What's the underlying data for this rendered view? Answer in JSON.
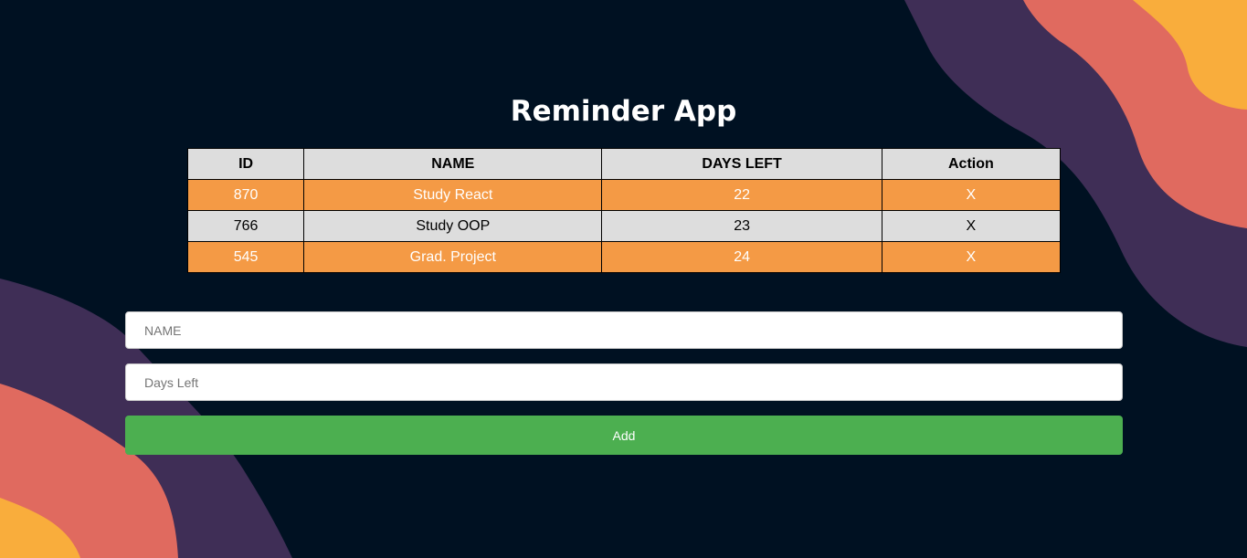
{
  "app": {
    "title": "Reminder App"
  },
  "table": {
    "headers": [
      "ID",
      "NAME",
      "DAYS LEFT",
      "Action"
    ],
    "rows": [
      {
        "id": "870",
        "name": "Study React",
        "days_left": "22",
        "action": "X"
      },
      {
        "id": "766",
        "name": "Study OOP",
        "days_left": "23",
        "action": "X"
      },
      {
        "id": "545",
        "name": "Grad. Project",
        "days_left": "24",
        "action": "X"
      }
    ]
  },
  "form": {
    "name_placeholder": "NAME",
    "name_value": "",
    "days_placeholder": "Days Left",
    "days_value": "",
    "add_label": "Add"
  },
  "colors": {
    "background": "#001122",
    "header_row": "#dddddd",
    "row_highlight": "#f49a45",
    "add_button": "#4caf50",
    "wave_purple": "#3f2e56",
    "wave_coral": "#e06a5f",
    "wave_yellow": "#f9ad3c"
  }
}
